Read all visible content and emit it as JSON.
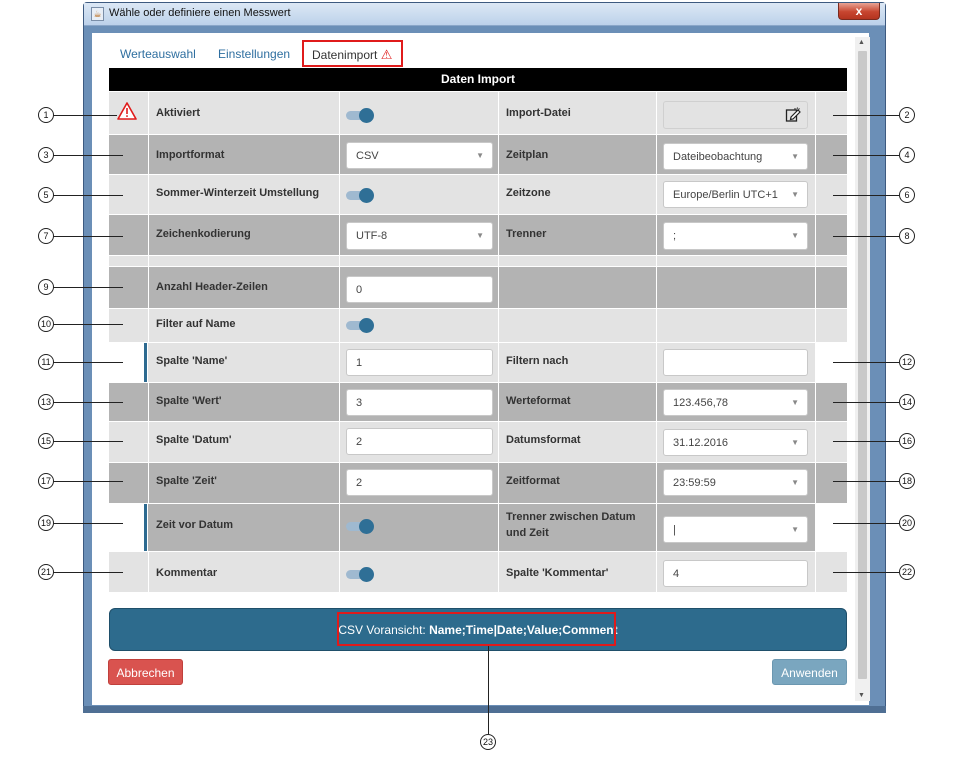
{
  "window": {
    "title": "Wähle oder definiere einen Messwert",
    "close_label": "x"
  },
  "tabs": [
    {
      "label": "Werteauswahl"
    },
    {
      "label": "Einstellungen"
    },
    {
      "label": "Datenimport"
    }
  ],
  "table_title": "Daten Import",
  "rows": {
    "aktiviert": "Aktiviert",
    "import_datei": "Import-Datei",
    "importformat": {
      "label": "Importformat",
      "value": "CSV"
    },
    "zeitplan": {
      "label": "Zeitplan",
      "value": "Dateibeobachtung"
    },
    "sommerzeit": "Sommer-Winterzeit Umstellung",
    "zeitzone": {
      "label": "Zeitzone",
      "value": "Europe/Berlin UTC+1"
    },
    "zeichenkodierung": {
      "label": "Zeichenkodierung",
      "value": "UTF-8"
    },
    "trenner": {
      "label": "Trenner",
      "value": ";"
    },
    "header_zeilen": {
      "label": "Anzahl Header-Zeilen",
      "value": "0"
    },
    "filter_name": "Filter auf Name",
    "spalte_name": {
      "label": "Spalte 'Name'",
      "value": "1"
    },
    "filtern_nach": {
      "label": "Filtern nach",
      "value": ""
    },
    "spalte_wert": {
      "label": "Spalte 'Wert'",
      "value": "3"
    },
    "werteformat": {
      "label": "Werteformat",
      "value": "123.456,78"
    },
    "spalte_datum": {
      "label": "Spalte 'Datum'",
      "value": "2"
    },
    "datumsformat": {
      "label": "Datumsformat",
      "value": "31.12.2016"
    },
    "spalte_zeit": {
      "label": "Spalte 'Zeit'",
      "value": "2"
    },
    "zeitformat": {
      "label": "Zeitformat",
      "value": "23:59:59"
    },
    "zeit_vor_datum": "Zeit vor Datum",
    "trenner_datum_zeit": {
      "label_line1": "Trenner zwischen Datum",
      "label_line2": "und Zeit",
      "value": "|"
    },
    "kommentar": "Kommentar",
    "spalte_kommentar": {
      "label": "Spalte 'Kommentar'",
      "value": "4"
    }
  },
  "preview": {
    "prefix": "CSV Voransicht: ",
    "value": "Name;Time|Date;Value;Comment"
  },
  "buttons": {
    "cancel": "Abbrechen",
    "apply": "Anwenden"
  },
  "callouts": [
    "1",
    "2",
    "3",
    "4",
    "5",
    "6",
    "7",
    "8",
    "9",
    "10",
    "11",
    "12",
    "13",
    "14",
    "15",
    "16",
    "17",
    "18",
    "19",
    "20",
    "21",
    "22",
    "23"
  ],
  "colors": {
    "accent": "#2d6b8d",
    "warning": "#e01b1b",
    "cancel": "#d9534f",
    "apply": "#7aa6bf"
  }
}
